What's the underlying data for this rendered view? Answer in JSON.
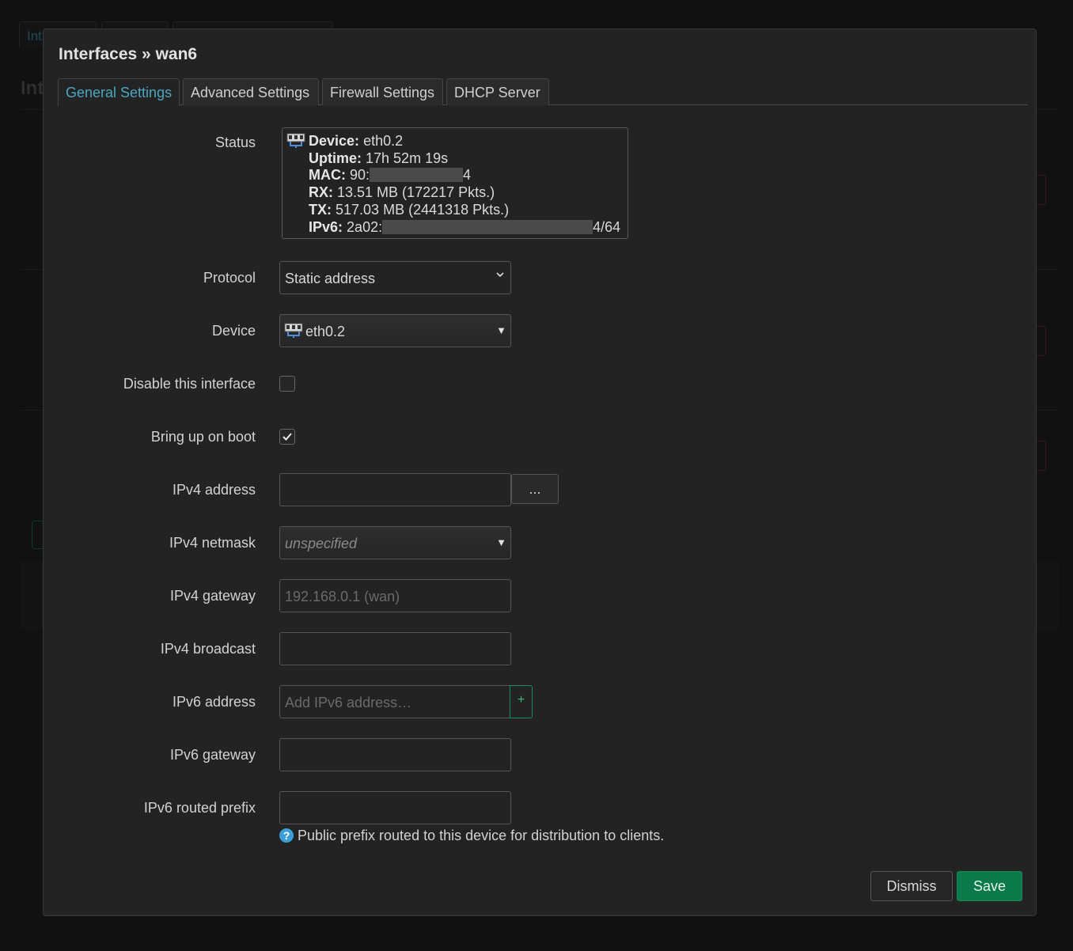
{
  "background": {
    "tab_fragment": "Int",
    "title_fragment": "Int"
  },
  "modal": {
    "title": "Interfaces » wan6",
    "tabs": [
      {
        "label": "General Settings",
        "active": true
      },
      {
        "label": "Advanced Settings",
        "active": false
      },
      {
        "label": "Firewall Settings",
        "active": false
      },
      {
        "label": "DHCP Server",
        "active": false
      }
    ],
    "status": {
      "label": "Status",
      "device_key": "Device:",
      "device_val": "eth0.2",
      "uptime_key": "Uptime:",
      "uptime_val": "17h 52m 19s",
      "mac_key": "MAC:",
      "mac_prefix": "90:",
      "mac_suffix": "4",
      "rx_key": "RX:",
      "rx_val": "13.51 MB (172217 Pkts.)",
      "tx_key": "TX:",
      "tx_val": "517.03 MB (2441318 Pkts.)",
      "ipv6_key": "IPv6:",
      "ipv6_prefix": "2a02:",
      "ipv6_suffix": "4/64"
    },
    "protocol": {
      "label": "Protocol",
      "value": "Static address"
    },
    "device": {
      "label": "Device",
      "value": "eth0.2",
      "icon": "network-port-icon"
    },
    "disable": {
      "label": "Disable this interface",
      "checked": false
    },
    "bring_up": {
      "label": "Bring up on boot",
      "checked": true
    },
    "ipv4_address": {
      "label": "IPv4 address",
      "value": "",
      "button": "..."
    },
    "ipv4_netmask": {
      "label": "IPv4 netmask",
      "value": "unspecified"
    },
    "ipv4_gateway": {
      "label": "IPv4 gateway",
      "placeholder": "192.168.0.1 (wan)"
    },
    "ipv4_broadcast": {
      "label": "IPv4 broadcast",
      "value": ""
    },
    "ipv6_address": {
      "label": "IPv6 address",
      "placeholder": "Add IPv6 address…",
      "button": "+"
    },
    "ipv6_gateway": {
      "label": "IPv6 gateway",
      "value": ""
    },
    "ipv6_prefix": {
      "label": "IPv6 routed prefix",
      "value": "",
      "help": "Public prefix routed to this device for distribution to clients."
    },
    "buttons": {
      "dismiss": "Dismiss",
      "save": "Save"
    },
    "colors": {
      "accent": "#4aa7c0",
      "save": "#0b7a4a",
      "help": "#3a9fd6"
    }
  }
}
